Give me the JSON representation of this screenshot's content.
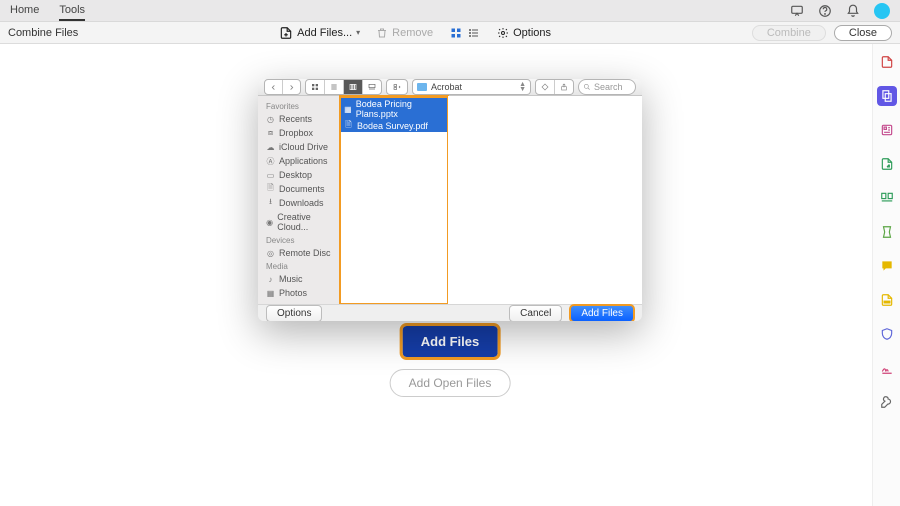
{
  "colors": {
    "highlight": "#f29b23",
    "primary_blue": "#153da8",
    "accent": "#6157e5"
  },
  "top": {
    "tabs": [
      "Home",
      "Tools"
    ],
    "active_tab": 1
  },
  "toolbar": {
    "title": "Combine Files",
    "add_files": "Add Files...",
    "remove": "Remove",
    "options": "Options",
    "combine": "Combine",
    "close": "Close"
  },
  "center": {
    "add_files": "Add Files",
    "add_open_files": "Add Open Files"
  },
  "dialog": {
    "location": "Acrobat",
    "search_placeholder": "Search",
    "sidebar": {
      "sections": [
        {
          "head": "Favorites",
          "items": [
            "Recents",
            "Dropbox",
            "iCloud Drive",
            "Applications",
            "Desktop",
            "Documents",
            "Downloads",
            "Creative Cloud..."
          ]
        },
        {
          "head": "Devices",
          "items": [
            "Remote Disc"
          ]
        },
        {
          "head": "Media",
          "items": [
            "Music",
            "Photos"
          ]
        }
      ]
    },
    "files": [
      "Bodea Pricing Plans.pptx",
      "Bodea Survey.pdf"
    ],
    "footer": {
      "options": "Options",
      "cancel": "Cancel",
      "add": "Add Files"
    }
  },
  "sidebar_icons": [
    "page",
    "edit",
    "form",
    "export",
    "organize",
    "compress",
    "comment",
    "redact",
    "protect",
    "sign",
    "more"
  ]
}
